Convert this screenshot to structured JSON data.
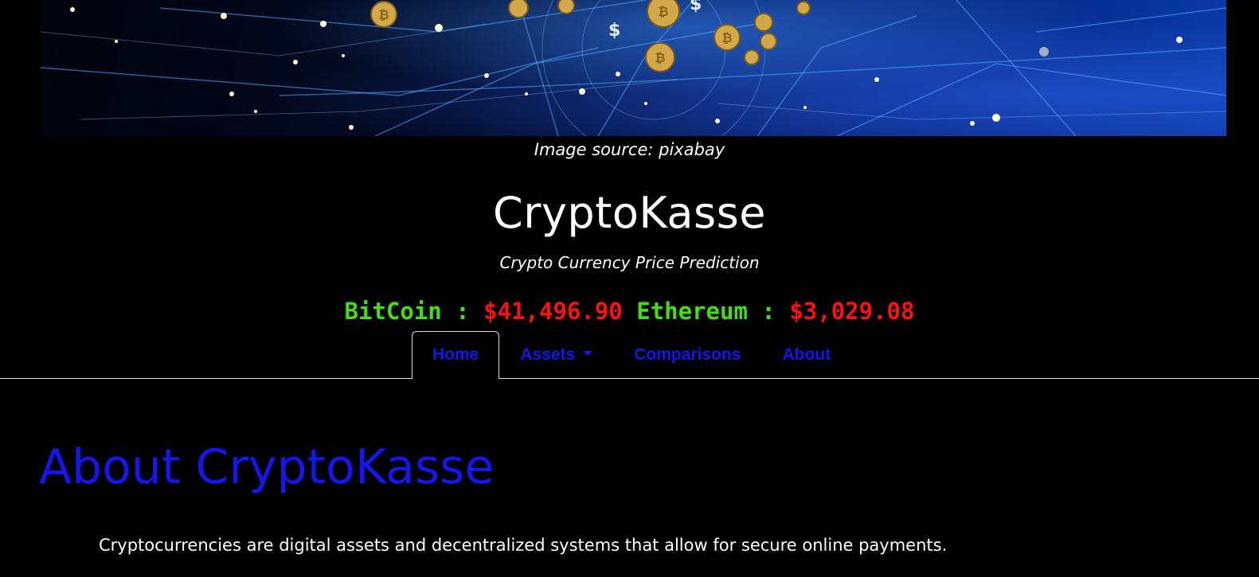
{
  "hero": {
    "image_alt": "Digital network with bitcoin coins"
  },
  "caption": "Image source: pixabay",
  "site": {
    "title": "CryptoKasse",
    "subtitle": "Crypto Currency Price Prediction"
  },
  "ticker": {
    "btc_name": "BitCoin :",
    "btc_price": "$41,496.90",
    "eth_name": "Ethereum :",
    "eth_price": "$3,029.08"
  },
  "nav": {
    "home": "Home",
    "assets": "Assets",
    "comparisons": "Comparisons",
    "about": "About",
    "active": "Home"
  },
  "about": {
    "heading": "About CryptoKasse",
    "text": "Cryptocurrencies are digital assets and decentralized systems that allow for secure online payments."
  },
  "colors": {
    "background": "#000000",
    "nav_link": "#1515ee",
    "ticker_name": "#44dd11",
    "ticker_price": "#ff1111",
    "heading": "#1515ee"
  }
}
